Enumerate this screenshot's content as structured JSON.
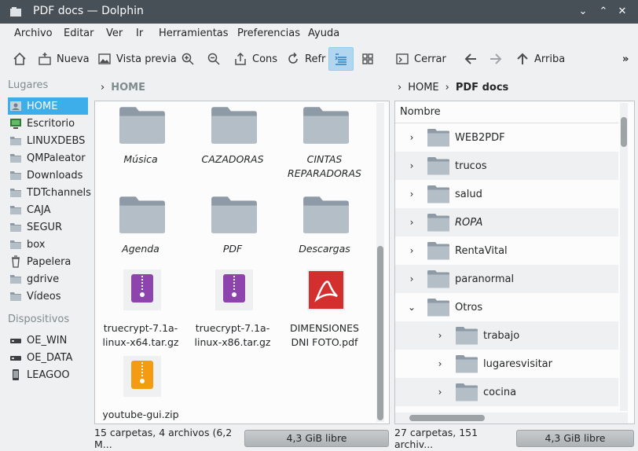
{
  "window": {
    "title": "PDF docs — Dolphin"
  },
  "menu": [
    "Archivo",
    "Editar",
    "Ver",
    "Ir",
    "Herramientas",
    "Preferencias",
    "Ayuda"
  ],
  "toolbar": {
    "new_label": "Nueva",
    "preview_label": "Vista previa",
    "cons_label": "Cons",
    "refr_label": "Refr",
    "close_label": "Cerrar",
    "up_label": "Arriba",
    "more": "»"
  },
  "places": {
    "title": "Lugares",
    "items": [
      "HOME",
      "Escritorio",
      "LINUXDEBS",
      "QMPaleator",
      "Downloads",
      "TDTchannels",
      "CAJA",
      "SEGUR",
      "box",
      "Papelera",
      "gdrive",
      "Vídeos"
    ],
    "devices_title": "Dispositivos",
    "devices": [
      "OE_WIN",
      "OE_DATA",
      "LEAGOO"
    ]
  },
  "left_pane": {
    "crumb": "HOME",
    "items": [
      {
        "label": "Música",
        "type": "folder",
        "italic": true
      },
      {
        "label": "CAZADORAS",
        "type": "folder",
        "italic": true
      },
      {
        "label": "CINTAS REPARADORAS",
        "type": "folder",
        "italic": true
      },
      {
        "label": "Agenda",
        "type": "folder",
        "italic": true
      },
      {
        "label": "PDF",
        "type": "folder",
        "italic": true
      },
      {
        "label": "Descargas",
        "type": "folder",
        "italic": true
      },
      {
        "label": "truecrypt-7.1a-linux-x64.tar.gz",
        "type": "archive",
        "italic": false
      },
      {
        "label": "truecrypt-7.1a-linux-x86.tar.gz",
        "type": "archive",
        "italic": false
      },
      {
        "label": "DIMENSIONES DNI FOTO.pdf",
        "type": "pdf",
        "italic": false
      },
      {
        "label": "youtube-gui.zip",
        "type": "zip",
        "italic": false
      }
    ],
    "status": "15 carpetas, 4 archivos (6,2 M...",
    "free": "4,3 GiB libre"
  },
  "right_pane": {
    "crumbs": [
      "HOME",
      "PDF docs"
    ],
    "column_header": "Nombre",
    "rows": [
      {
        "label": "WEB2PDF",
        "level": 0,
        "expanded": false,
        "italic": false
      },
      {
        "label": "trucos",
        "level": 0,
        "expanded": false,
        "italic": false
      },
      {
        "label": "salud",
        "level": 0,
        "expanded": false,
        "italic": false
      },
      {
        "label": "ROPA",
        "level": 0,
        "expanded": false,
        "italic": true
      },
      {
        "label": "RentaVital",
        "level": 0,
        "expanded": false,
        "italic": false
      },
      {
        "label": "paranormal",
        "level": 0,
        "expanded": false,
        "italic": false
      },
      {
        "label": "Otros",
        "level": 0,
        "expanded": true,
        "italic": false
      },
      {
        "label": "trabajo",
        "level": 1,
        "expanded": false,
        "italic": false
      },
      {
        "label": "lugaresvisitar",
        "level": 1,
        "expanded": false,
        "italic": false
      },
      {
        "label": "cocina",
        "level": 1,
        "expanded": false,
        "italic": false
      }
    ],
    "status": "27 carpetas, 151 archiv...",
    "free": "4,3 GiB libre"
  },
  "colors": {
    "titlebar": "#475057",
    "selection": "#3daee9",
    "folder": "#a6b2bc"
  }
}
